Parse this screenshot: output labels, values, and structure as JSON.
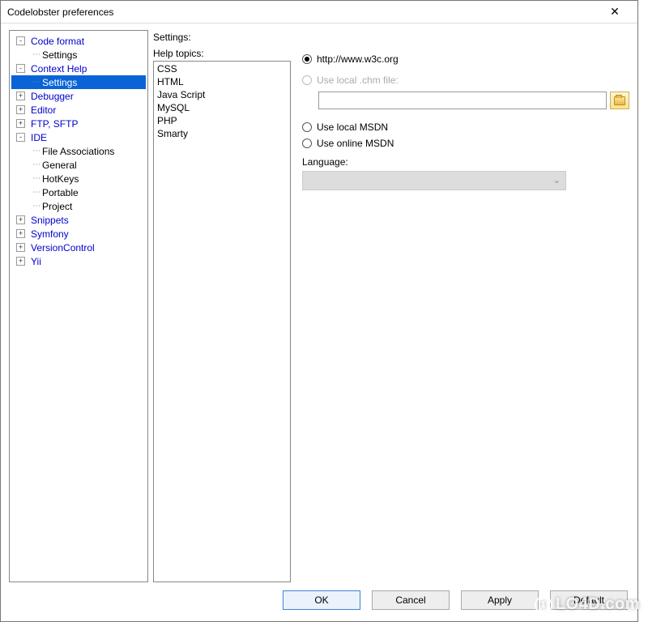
{
  "window": {
    "title": "Codelobster preferences"
  },
  "tree": [
    {
      "level": 0,
      "toggle": "-",
      "label": "Code format",
      "blue": true
    },
    {
      "level": 1,
      "toggle": "",
      "label": "Settings",
      "blue": false
    },
    {
      "level": 0,
      "toggle": "-",
      "label": "Context Help",
      "blue": true
    },
    {
      "level": 1,
      "toggle": "",
      "label": "Settings",
      "blue": false,
      "selected": true
    },
    {
      "level": 0,
      "toggle": "+",
      "label": "Debugger",
      "blue": true
    },
    {
      "level": 0,
      "toggle": "+",
      "label": "Editor",
      "blue": true
    },
    {
      "level": 0,
      "toggle": "+",
      "label": "FTP, SFTP",
      "blue": true
    },
    {
      "level": 0,
      "toggle": "-",
      "label": "IDE",
      "blue": true
    },
    {
      "level": 1,
      "toggle": "",
      "label": "File Associations",
      "blue": false
    },
    {
      "level": 1,
      "toggle": "",
      "label": "General",
      "blue": false
    },
    {
      "level": 1,
      "toggle": "",
      "label": "HotKeys",
      "blue": false
    },
    {
      "level": 1,
      "toggle": "",
      "label": "Portable",
      "blue": false
    },
    {
      "level": 1,
      "toggle": "",
      "label": "Project",
      "blue": false
    },
    {
      "level": 0,
      "toggle": "+",
      "label": "Snippets",
      "blue": true
    },
    {
      "level": 0,
      "toggle": "+",
      "label": "Symfony",
      "blue": true
    },
    {
      "level": 0,
      "toggle": "+",
      "label": "VersionControl",
      "blue": true
    },
    {
      "level": 0,
      "toggle": "+",
      "label": "Yii",
      "blue": true
    }
  ],
  "settings": {
    "title": "Settings:",
    "help_label": "Help topics:",
    "help_topics": [
      "CSS",
      "HTML",
      "Java Script",
      "MySQL",
      "PHP",
      "Smarty"
    ],
    "radio_w3c": "http://www.w3c.org",
    "radio_chm": "Use local .chm file:",
    "radio_msdn_local": "Use local MSDN",
    "radio_msdn_online": "Use online MSDN",
    "language_label": "Language:",
    "browse_tooltip": "Browse"
  },
  "buttons": {
    "ok": "OK",
    "cancel": "Cancel",
    "apply": "Apply",
    "default": "Default"
  },
  "watermark": "LO4D.com"
}
